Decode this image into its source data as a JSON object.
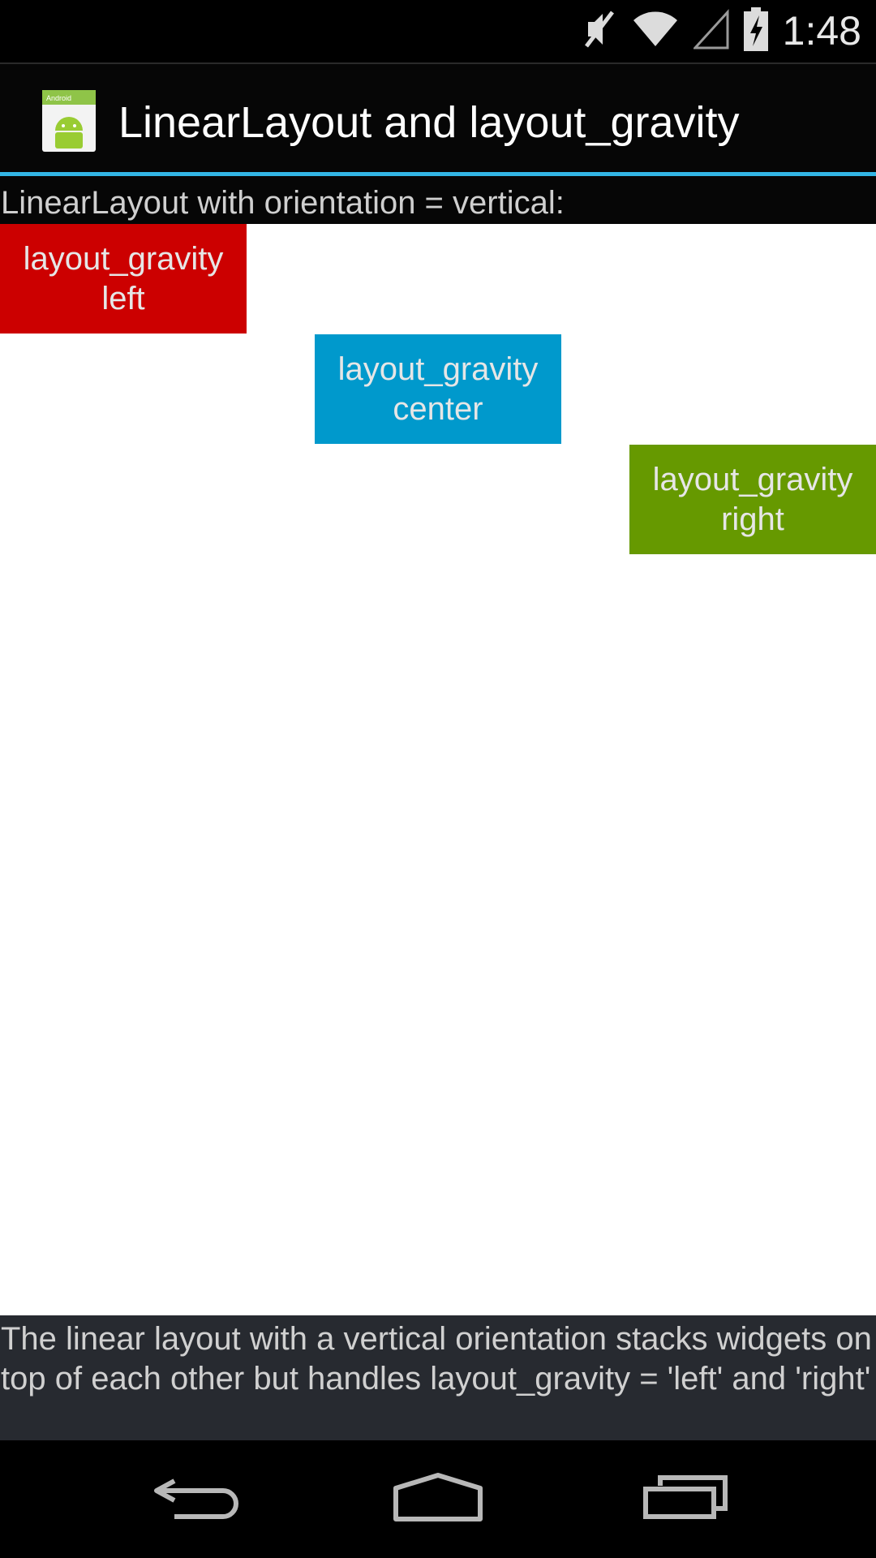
{
  "status_bar": {
    "time": "1:48",
    "icons": [
      "mute-icon",
      "wifi-icon",
      "cell-signal-icon",
      "battery-charging-icon"
    ]
  },
  "action_bar": {
    "app_icon": "android-app-icon",
    "title": "LinearLayout and layout_gravity",
    "accent_color": "#33b5e5"
  },
  "header": {
    "label": "LinearLayout with orientation = vertical:"
  },
  "boxes": [
    {
      "line1": "layout_gravity",
      "line2": "left",
      "color": "#cc0000"
    },
    {
      "line1": "layout_gravity",
      "line2": "center",
      "color": "#0099cc"
    },
    {
      "line1": "layout_gravity",
      "line2": "right",
      "color": "#669900"
    }
  ],
  "description": {
    "text": "The linear layout with a vertical orientation stacks widgets on top of each other but handles layout_gravity = 'left' and 'right'"
  },
  "nav_bar": {
    "icons": [
      "back-icon",
      "home-icon",
      "recents-icon"
    ]
  }
}
